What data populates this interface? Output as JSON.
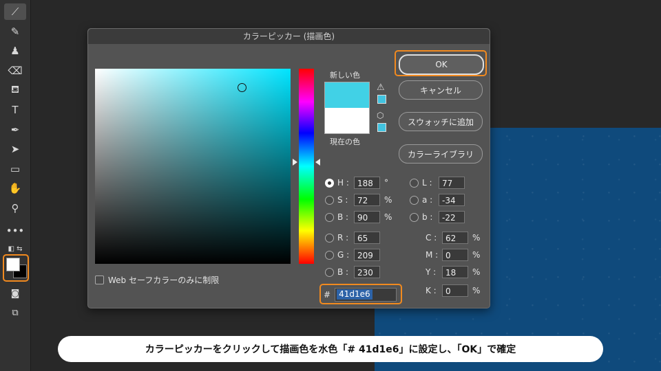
{
  "dialog": {
    "title": "カラーピッカー (描画色)",
    "new_label": "新しい色",
    "current_label": "現在の色",
    "new_color": "#41d1e6",
    "current_color": "#ffffff",
    "websafe_label": "Web セーフカラーのみに制限",
    "buttons": {
      "ok": "OK",
      "cancel": "キャンセル",
      "add_swatch": "スウォッチに追加",
      "libraries": "カラーライブラリ"
    },
    "hsb": {
      "h_label": "H :",
      "h_value": "188",
      "h_unit": "°",
      "s_label": "S :",
      "s_value": "72",
      "s_unit": "%",
      "b_label": "B :",
      "b_value": "90",
      "b_unit": "%"
    },
    "rgb": {
      "r_label": "R :",
      "r_value": "65",
      "g_label": "G :",
      "g_value": "209",
      "b_label": "B :",
      "b_value": "230"
    },
    "lab": {
      "l_label": "L :",
      "l_value": "77",
      "a_label": "a :",
      "a_value": "-34",
      "b_label": "b :",
      "b_value": "-22"
    },
    "cmyk": {
      "c_label": "C :",
      "c_value": "62",
      "c_unit": "%",
      "m_label": "M :",
      "m_value": "0",
      "m_unit": "%",
      "y_label": "Y :",
      "y_value": "18",
      "y_unit": "%",
      "k_label": "K :",
      "k_value": "0",
      "k_unit": "%"
    },
    "hex_prefix": "#",
    "hex_value": "41d1e6"
  },
  "toolbar": {
    "icons": [
      "eyedropper-icon",
      "brush-icon",
      "stamp-icon",
      "eraser-icon",
      "paint-bucket-icon",
      "type-icon",
      "pen-icon",
      "selection-arrow-icon",
      "rectangle-icon",
      "hand-icon",
      "zoom-icon",
      "more-icon"
    ]
  },
  "caption": "カラーピッカーをクリックして描画色を水色「# 41d1e6」に設定し、「OK」で確定",
  "colors": {
    "highlight": "#f28a1f",
    "document": "#0f4a7c"
  }
}
